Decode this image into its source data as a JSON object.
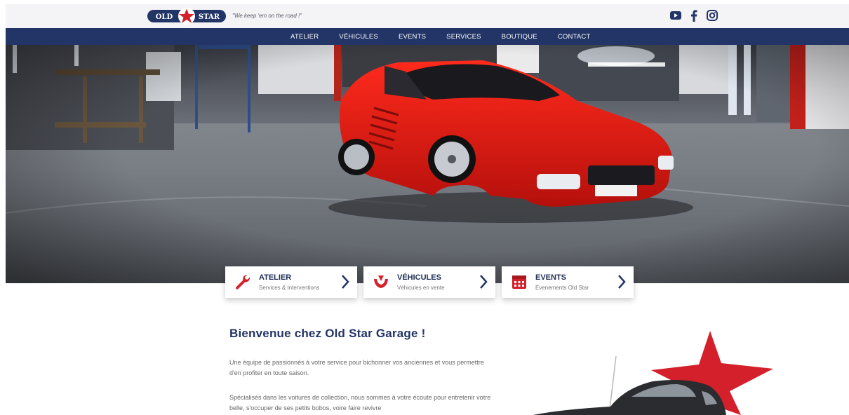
{
  "header": {
    "logo_left": "OLD",
    "logo_right": "STAR",
    "tagline": "\"We keep 'em on the road !\"",
    "socials": [
      {
        "icon": "youtube-icon"
      },
      {
        "icon": "facebook-icon"
      },
      {
        "icon": "instagram-icon"
      }
    ]
  },
  "nav": {
    "items": [
      "ATELIER",
      "VÉHICULES",
      "EVENTS",
      "SERVICES",
      "BOUTIQUE",
      "CONTACT"
    ]
  },
  "cards": [
    {
      "title": "ATELIER",
      "subtitle": "Services & Interventions",
      "icon": "wrench-icon"
    },
    {
      "title": "VÉHICULES",
      "subtitle": "Véhicules en vente",
      "icon": "steering-icon"
    },
    {
      "title": "EVENTS",
      "subtitle": "Évenements Old Star",
      "icon": "calendar-icon"
    }
  ],
  "welcome": {
    "title": "Bienvenue chez Old Star Garage !",
    "paragraph1": "Une équipe de passionnés à votre service pour bichonner vos anciennes et vous permettre d'en profiter en toute saison.",
    "paragraph2": "Spécialisés dans les voitures de collection, nous sommes à votre écoute pour entretenir votre belle, s'occuper de ses petits bobos, voire faire revivre"
  },
  "colors": {
    "navy": "#223566",
    "red": "#d4202a",
    "topbar": "#f4f4f6"
  }
}
